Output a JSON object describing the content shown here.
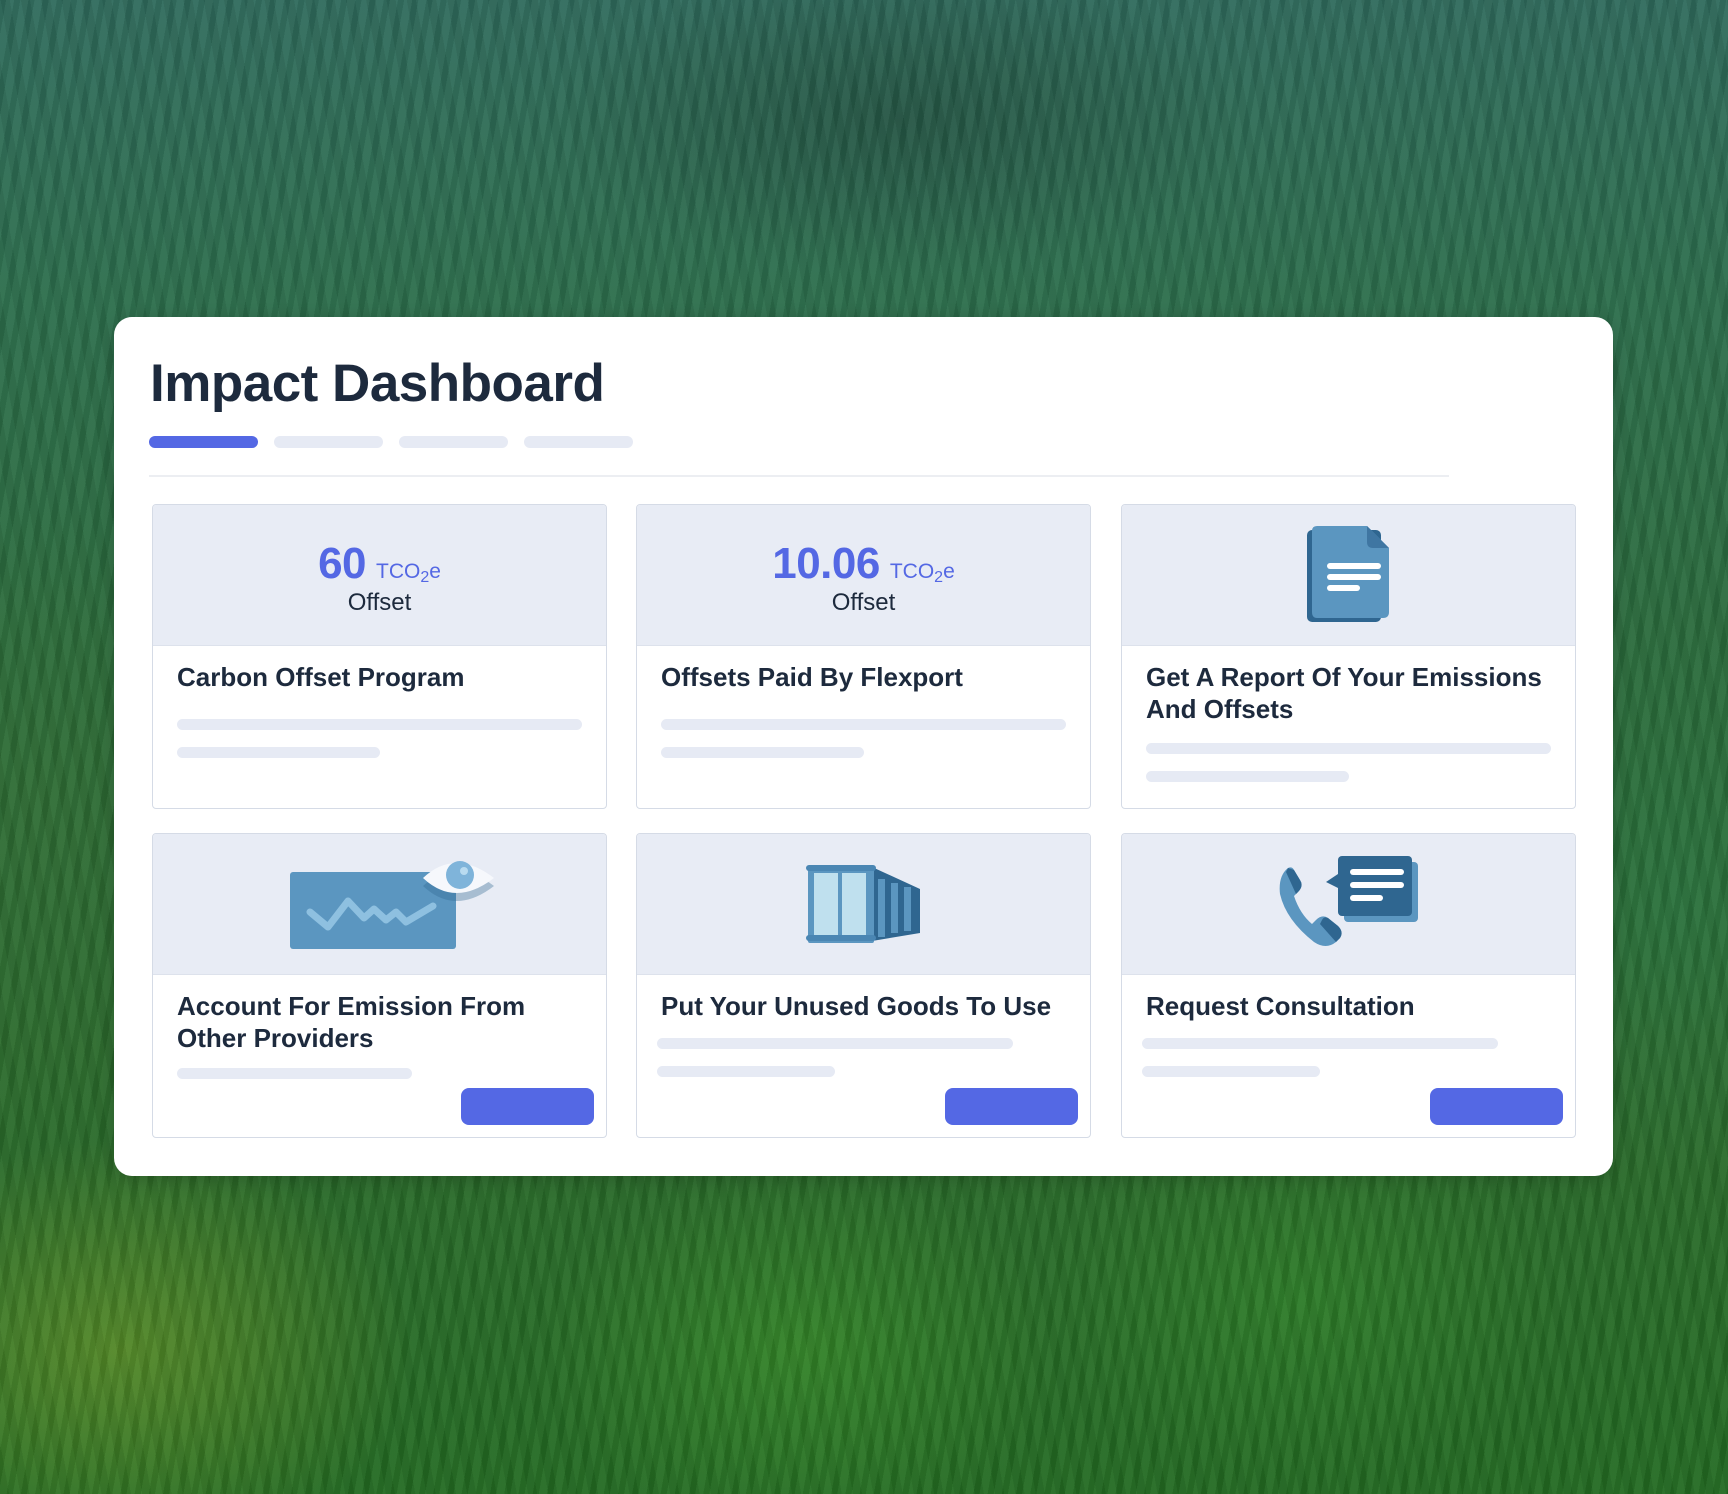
{
  "dashboard": {
    "title": "Impact Dashboard",
    "tabs": [
      {
        "state": "active"
      },
      {
        "state": "inactive"
      },
      {
        "state": "inactive"
      },
      {
        "state": "inactive"
      }
    ],
    "accent_color": "#5468e4"
  },
  "cards": [
    {
      "title": "Carbon Offset Program",
      "metric": {
        "value": "60",
        "unit": "TCO",
        "unit_sub": "2",
        "unit_suffix": "e",
        "label": "Offset"
      },
      "has_button": false
    },
    {
      "title": "Offsets Paid By Flexport",
      "metric": {
        "value": "10.06",
        "unit": "TCO",
        "unit_sub": "2",
        "unit_suffix": "e",
        "label": "Offset"
      },
      "has_button": false
    },
    {
      "title": "Get A Report Of Your Emissions And Offsets",
      "icon": "document-icon",
      "has_button": false
    },
    {
      "title": "Account For Emission From Other Providers",
      "icon": "chart-eye-icon",
      "has_button": true
    },
    {
      "title": "Put Your Unused Goods To Use",
      "icon": "shipping-container-icon",
      "has_button": true
    },
    {
      "title": "Request Consultation",
      "icon": "phone-chat-icon",
      "has_button": true
    }
  ]
}
